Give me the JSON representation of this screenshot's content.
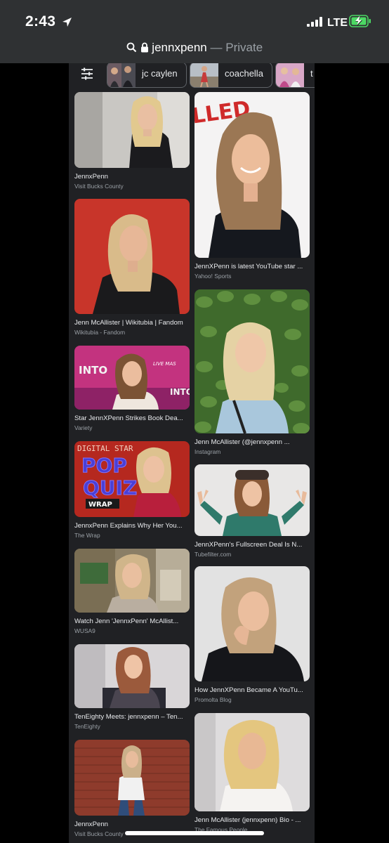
{
  "status_bar": {
    "time": "2:43",
    "carrier": "LTE",
    "icons": [
      "location-arrow-icon",
      "signal-bars-icon",
      "battery-charging-icon"
    ]
  },
  "url_bar": {
    "domain": "jennxpenn",
    "separator": "—",
    "mode": "Private",
    "icons": [
      "search-icon",
      "lock-icon"
    ]
  },
  "chips": [
    {
      "label": "jc caylen"
    },
    {
      "label": "coachella"
    },
    {
      "label": "t"
    }
  ],
  "results": [
    {
      "title": "JennxPenn",
      "source": "Visit Bucks County"
    },
    {
      "title": "Jenn McAllister | Wikitubia | Fandom",
      "source": "Wikitubia - Fandom"
    },
    {
      "title": "Star JennXPenn Strikes Book Dea...",
      "source": "Variety",
      "sign_text": "INTO",
      "sign_text2": "INTO",
      "badge": "LIVE MAS"
    },
    {
      "title": "JennxPenn Explains Why Her You...",
      "source": "The Wrap",
      "line1": "DIGITAL STAR",
      "line2": "POP",
      "line3": "QUIZ",
      "logo": "WRAP"
    },
    {
      "title": "Watch Jenn 'JennxPenn' McAllist...",
      "source": "WUSA9"
    },
    {
      "title": "TenEighty Meets: jennxpenn – Ten...",
      "source": "TenEighty"
    },
    {
      "title": "JennxPenn",
      "source": "Visit Bucks County"
    },
    {
      "title": "JennXPenn is latest YouTube star ...",
      "source": "Yahoo! Sports",
      "banner": "LLED"
    },
    {
      "title": "Jenn McAllister (@jennxpenn ...",
      "source": "Instagram"
    },
    {
      "title": "JennXPenn's Fullscreen Deal Is N...",
      "source": "Tubefilter.com"
    },
    {
      "title": "How JennXPenn Became A YouTu...",
      "source": "Promolta Blog"
    },
    {
      "title": "Jenn McAllister (jennxpenn) Bio - ...",
      "source": "The Famous People"
    }
  ]
}
